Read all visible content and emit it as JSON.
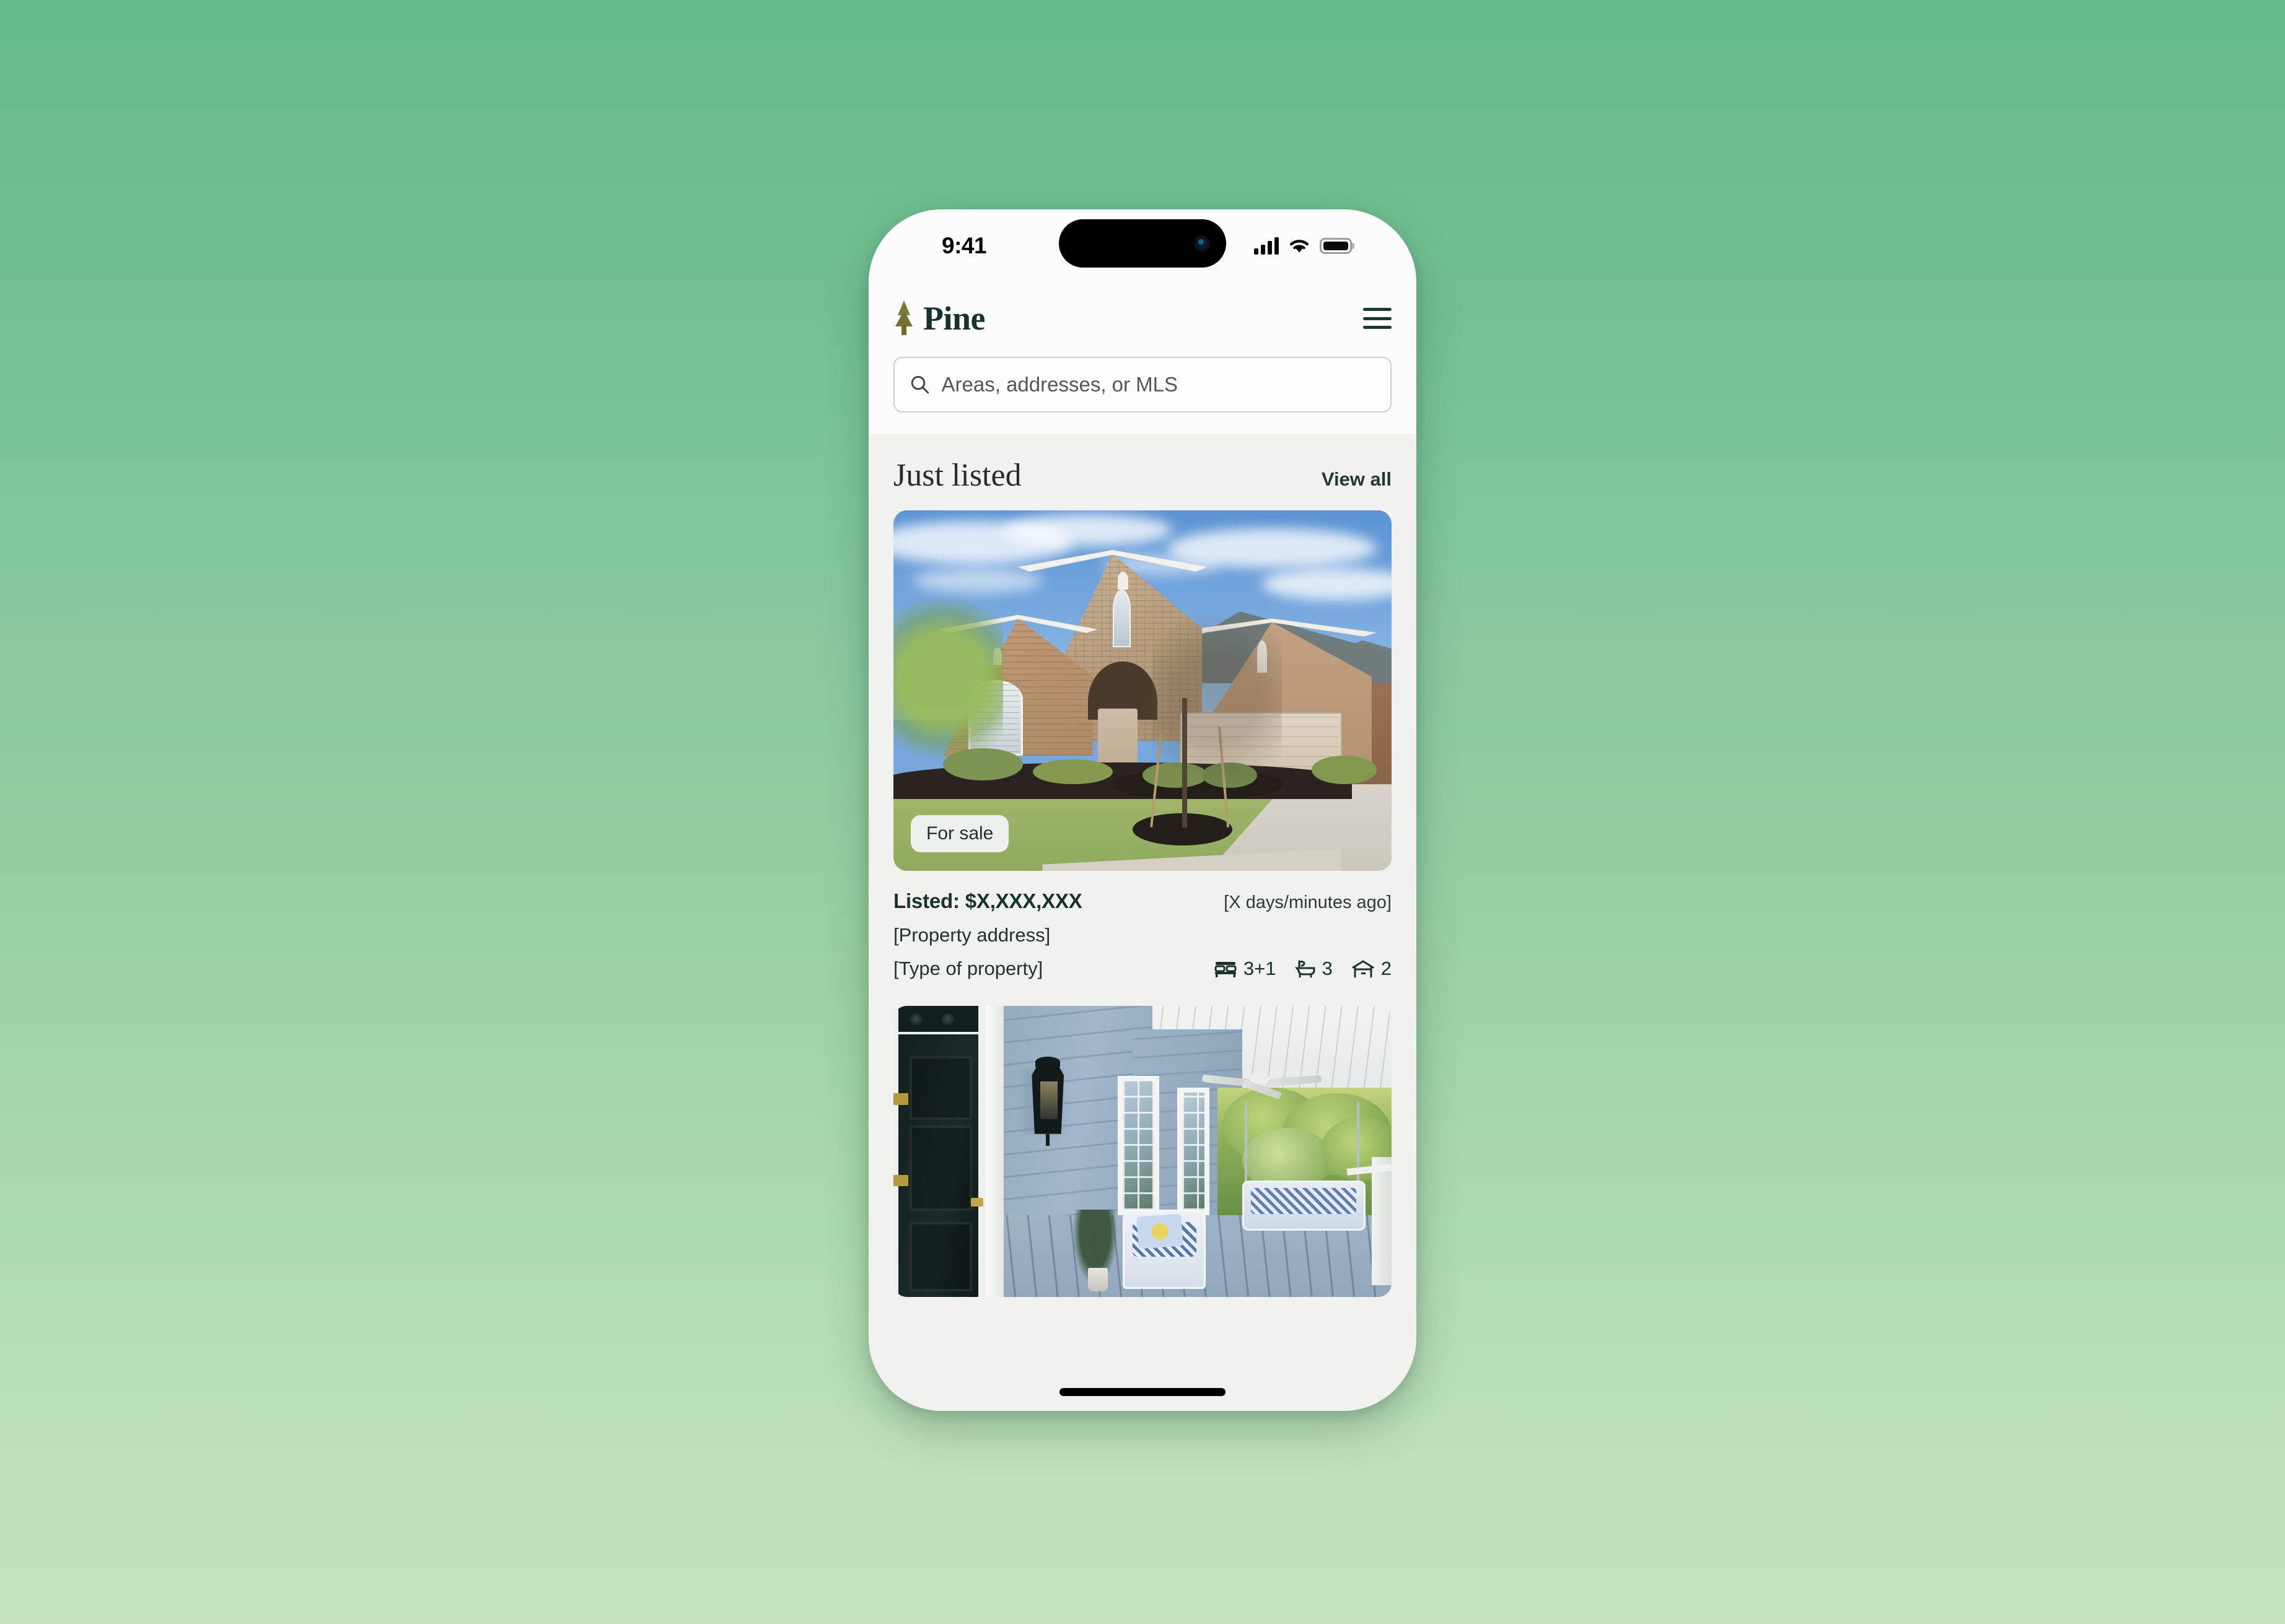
{
  "status_bar": {
    "time": "9:41",
    "icons": [
      "cellular-signal",
      "wifi",
      "battery"
    ]
  },
  "header": {
    "brand_name": "Pine",
    "brand_icon": "pine-tree-icon",
    "menu_icon": "hamburger-menu-icon"
  },
  "search": {
    "placeholder": "Areas, addresses, or MLS",
    "value": "",
    "icon": "search-icon"
  },
  "section": {
    "title": "Just listed",
    "view_all_label": "View all"
  },
  "listings": [
    {
      "badge": "For sale",
      "price": "Listed: $X,XXX,XXX",
      "time_ago": "[X days/minutes ago]",
      "address": "[Property address]",
      "property_type": "[Type of property]",
      "specs": [
        {
          "icon": "bed-icon",
          "value": "3+1"
        },
        {
          "icon": "bath-icon",
          "value": "3"
        },
        {
          "icon": "garage-icon",
          "value": "2"
        }
      ],
      "photo_alt": "brick-house-exterior-photo"
    },
    {
      "photo_alt": "blue-porch-with-swing-photo"
    }
  ],
  "colors": {
    "brand_dark_green": "#16332c",
    "accent_olive": "#7d7a32",
    "page_background_top": "#63bb8a",
    "page_background_bottom": "#c3e2bd",
    "screen_background": "#f1f1f0",
    "header_background": "#fcfcfc",
    "badge_background": "#eef0ed"
  }
}
